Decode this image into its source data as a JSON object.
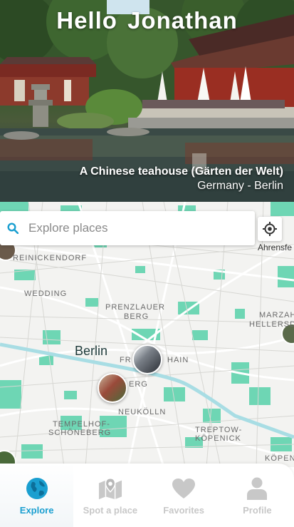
{
  "hero": {
    "greeting": "Hello  Jonathan",
    "title": "A Chinese teahouse (Gärten der Welt)",
    "location": "Germany - Berlin"
  },
  "search": {
    "placeholder": "Explore places",
    "icon": "search-icon"
  },
  "map": {
    "city": "Berlin",
    "labels": {
      "reinickendorf": "REINICKENDORF",
      "wedding": "WEDDING",
      "prenzlauer_1": "PRENZLAUER",
      "prenzlauer_2": "BERG",
      "friedrichshain_1": "FR",
      "friedrichshain_2": "HAIN",
      "kreuzberg_1": "K",
      "kreuzberg_2": "ERG",
      "neukolln": "NEUKÖLLN",
      "tempelhof_1": "TEMPELHOF-",
      "tempelhof_2": "SCHÖNEBERG",
      "treptow_1": "TREPTOW-",
      "treptow_2": "KÖPENICK",
      "marzahn": "MARZAH",
      "hellersdorf": "HELLERSDO",
      "kopenick": "KÖPEN",
      "ahrensfelde": "Ahrensfe"
    },
    "locate_icon": "crosshair-icon"
  },
  "nav": {
    "items": [
      {
        "label": "Explore",
        "icon": "globe-icon",
        "active": true
      },
      {
        "label": "Spot a place",
        "icon": "map-pin-icon",
        "active": false
      },
      {
        "label": "Favorites",
        "icon": "heart-icon",
        "active": false
      },
      {
        "label": "Profile",
        "icon": "user-icon",
        "active": false
      }
    ]
  },
  "colors": {
    "accent": "#1a9fd0",
    "map_green": "#6ed6b4",
    "inactive": "#c8c8c8"
  }
}
